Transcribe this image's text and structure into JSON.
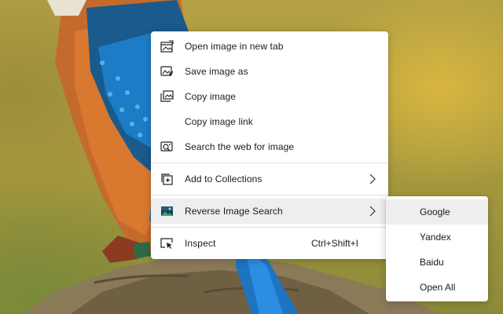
{
  "menu": {
    "items": [
      {
        "label": "Open image in new tab",
        "icon": "open-image-new-tab-icon"
      },
      {
        "label": "Save image as",
        "icon": "save-image-icon"
      },
      {
        "label": "Copy image",
        "icon": "copy-image-icon"
      },
      {
        "label": "Copy image link",
        "icon": ""
      },
      {
        "label": "Search the web for image",
        "icon": "visual-search-icon"
      },
      {
        "label": "Add to Collections",
        "icon": "collections-icon",
        "has_submenu": true
      },
      {
        "label": "Reverse Image Search",
        "icon": "reverse-image-search-extension-icon",
        "has_submenu": true
      },
      {
        "label": "Inspect",
        "icon": "inspect-icon",
        "shortcut": "Ctrl+Shift+I"
      }
    ]
  },
  "submenu": {
    "items": [
      {
        "label": "Google"
      },
      {
        "label": "Yandex"
      },
      {
        "label": "Baidu"
      },
      {
        "label": "Open All"
      }
    ]
  },
  "colors": {
    "menu_bg": "#ffffff",
    "hover_bg": "#eeeeee",
    "separator": "#e1e1e1",
    "text": "#1b1b1b"
  }
}
